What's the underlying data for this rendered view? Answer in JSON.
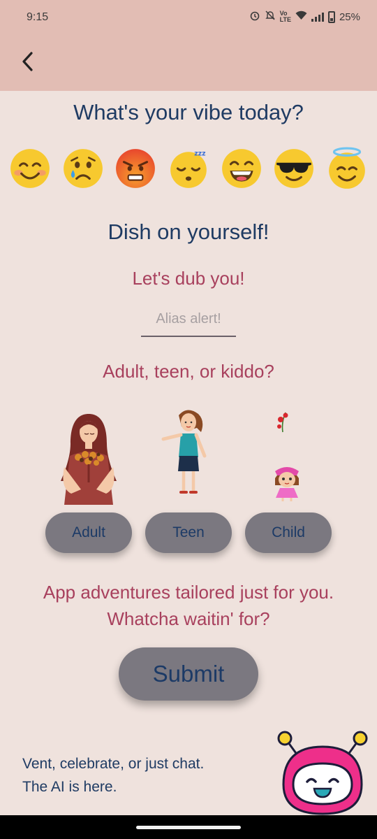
{
  "status_bar": {
    "time": "9:15",
    "battery": "25%",
    "icons": [
      "alarm-icon",
      "mute-icon",
      "volte-icon",
      "wifi-icon",
      "signal-icon",
      "battery-icon"
    ]
  },
  "header": {
    "back_icon": "chevron-left-icon",
    "background": "#e2bdb4"
  },
  "vibe": {
    "title": "What's your vibe today?",
    "emojis": [
      "😊",
      "😢",
      "😡",
      "😴",
      "😄",
      "😎",
      "😇"
    ]
  },
  "profile": {
    "title": "Dish on yourself!",
    "name_prompt": "Let's dub you!",
    "alias_value": "",
    "alias_placeholder": "Alias alert!",
    "age_prompt": "Adult, teen, or kiddo?",
    "age_options": [
      "Adult",
      "Teen",
      "Child"
    ]
  },
  "promo": {
    "line1": "App adventures tailored just for you.",
    "line2": "Whatcha waitin' for?"
  },
  "submit_label": "Submit",
  "footer": {
    "line1": "Vent, celebrate, or just chat.",
    "line2": "The AI is here."
  },
  "colors": {
    "background": "#efe2dd",
    "navy_text": "#1f3b63",
    "accent_text": "#a8405d",
    "button": "#7b7880"
  }
}
